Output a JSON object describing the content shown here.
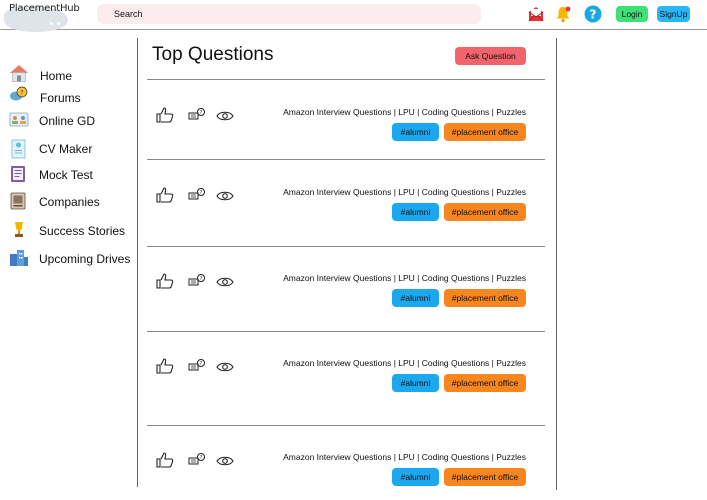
{
  "app": {
    "logo_text": "PlacementHub"
  },
  "header": {
    "search_label": "Search",
    "login_label": "Login",
    "signup_label": "SignUp"
  },
  "colors": {
    "login": "#3fe078",
    "signup": "#29b6f6",
    "ask_button": "#f1646c",
    "tag_alumni": "#1ba8ee",
    "tag_placement": "#f7861e",
    "search_bg": "#fcecee"
  },
  "sidebar": {
    "items": [
      {
        "label": "Home",
        "icon": "home-icon"
      },
      {
        "label": "Forums",
        "icon": "forums-icon"
      },
      {
        "label": "Online GD",
        "icon": "online-gd-icon"
      },
      {
        "label": "CV Maker",
        "icon": "cv-maker-icon"
      },
      {
        "label": "Mock Test",
        "icon": "mock-test-icon"
      },
      {
        "label": "Companies",
        "icon": "companies-icon"
      },
      {
        "label": "Success Stories",
        "icon": "trophy-icon"
      },
      {
        "label": "Upcoming Drives",
        "icon": "buildings-icon"
      }
    ]
  },
  "main": {
    "title": "Top Questions",
    "ask_label": "Ask Question",
    "questions": [
      {
        "title": "Amazon Interview Questions | LPU |  Coding Questions | Puzzles",
        "tags": [
          "#alumni",
          "#placement office"
        ]
      },
      {
        "title": "Amazon Interview Questions | LPU |  Coding Questions | Puzzles",
        "tags": [
          "#alumni",
          "#placement office"
        ]
      },
      {
        "title": "Amazon Interview Questions | LPU |  Coding Questions | Puzzles",
        "tags": [
          "#alumni",
          "#placement office"
        ]
      },
      {
        "title": "Amazon Interview Questions | LPU |  Coding Questions | Puzzles",
        "tags": [
          "#alumni",
          "#placement office"
        ]
      },
      {
        "title": "Amazon Interview Questions | LPU |  Coding Questions | Puzzles",
        "tags": [
          "#alumni",
          "#placement office"
        ]
      }
    ]
  }
}
